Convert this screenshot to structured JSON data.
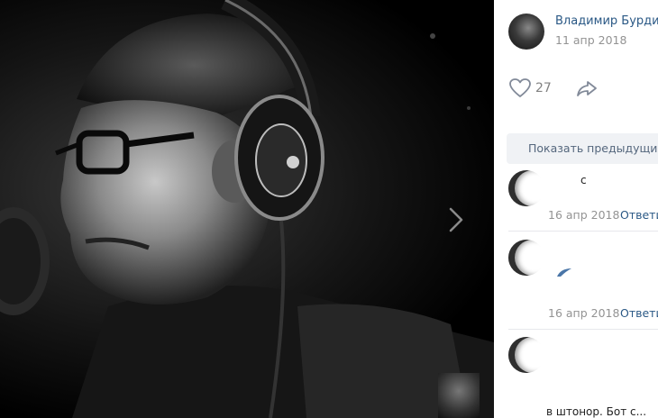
{
  "post": {
    "author": "Владимир Бурдин",
    "date": "11 апр 2018",
    "likes": "27"
  },
  "comments_panel": {
    "show_previous_label": "Показать предыдущие",
    "comments": [
      {
        "text": "с",
        "date": "16 апр 2018",
        "reply_label": "Ответи"
      },
      {
        "text": "",
        "date": "16 апр 2018",
        "reply_label": "Ответи"
      },
      {
        "text": "в штонор. Бот с..."
      }
    ]
  },
  "icons": {
    "like": "heart-icon",
    "share": "share-arrow-icon",
    "next": "chevron-right-icon"
  }
}
